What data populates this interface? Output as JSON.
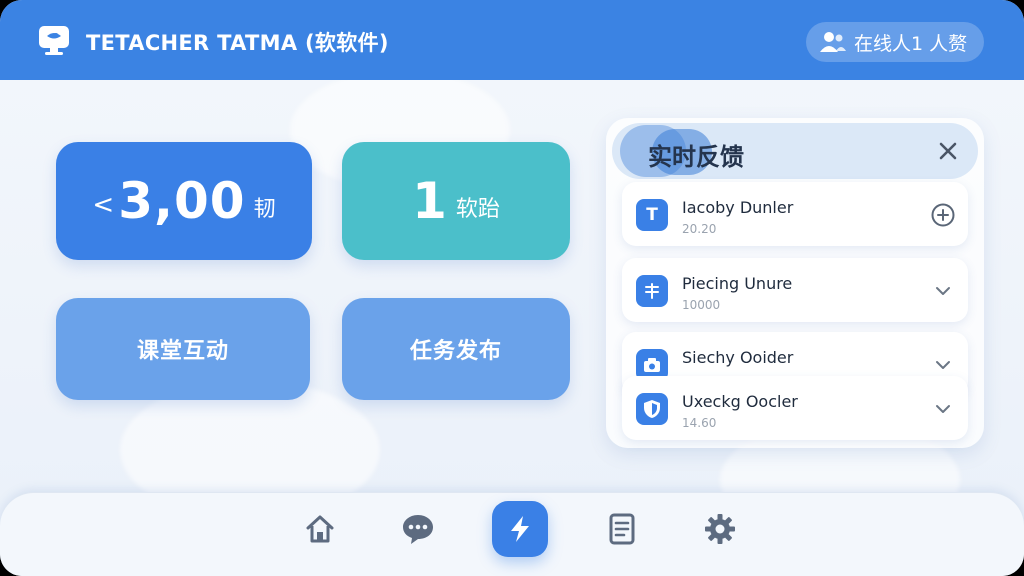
{
  "header": {
    "title": "TETACHER TATMA (软软件)",
    "online_label": "在线人1 人赘"
  },
  "stats": {
    "points_prefix": "<",
    "points_value": "3,00",
    "points_unit": "韧",
    "count_value": "1",
    "count_unit": "软跆"
  },
  "actions": {
    "interact_label": "课堂互动",
    "task_label": "任务发布"
  },
  "feedback": {
    "title": "实时反馈",
    "items": [
      {
        "icon": "T",
        "name": "Iacoby Dunler",
        "sub": "20.20",
        "action": "add-circle-icon"
      },
      {
        "icon": "pin",
        "name": "Piecing Unure",
        "sub": "10000",
        "action": "chevron-down-icon"
      },
      {
        "icon": "camera",
        "name": "Siechy Ooider",
        "sub": "",
        "action": "chevron-down-icon"
      },
      {
        "icon": "shield",
        "name": "Uxeckg Oocler",
        "sub": "14.60",
        "action": "chevron-down-icon"
      }
    ]
  },
  "nav": [
    "home-icon",
    "chat-icon",
    "lightning-icon",
    "document-icon",
    "gear-icon"
  ],
  "colors": {
    "primary": "#3a80e6",
    "teal": "#4bbfca",
    "soft_blue": "#6aa2ea",
    "header": "#3b83e3"
  }
}
